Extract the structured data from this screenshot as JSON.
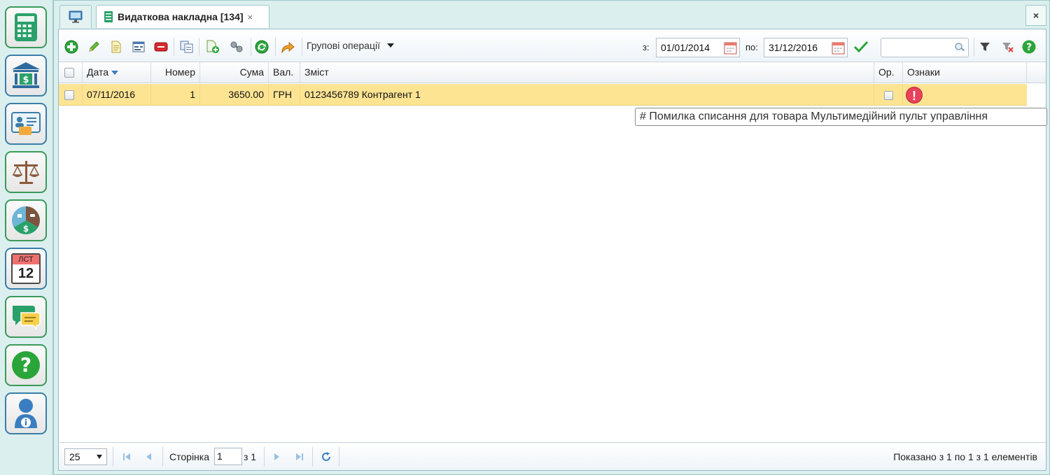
{
  "colors": {
    "sidebar_border_green": "#3a9a5a",
    "sidebar_border_blue": "#3a7ea8",
    "selected_row": "#fde493",
    "warning": "#e8435a",
    "accent_green": "#2aa53a"
  },
  "sidebar": {
    "items": [
      {
        "icon": "calculator-icon"
      },
      {
        "icon": "bank-icon"
      },
      {
        "icon": "contact-card-icon"
      },
      {
        "icon": "scales-icon"
      },
      {
        "icon": "property-chart-icon"
      },
      {
        "icon": "calendar-icon",
        "month": "ЛСТ",
        "day": "12"
      },
      {
        "icon": "chat-icon"
      },
      {
        "icon": "help-icon"
      },
      {
        "icon": "user-info-icon"
      }
    ]
  },
  "tabs": {
    "active_title": "Видаткова накладна [134]",
    "close_glyph": "×",
    "window_close_glyph": "×"
  },
  "toolbar": {
    "group_ops_label": "Групові операції",
    "from_label": "з:",
    "from_date": "01/01/2014",
    "to_label": "по:",
    "to_date": "31/12/2016",
    "search_value": ""
  },
  "grid": {
    "columns": {
      "date": "Дата",
      "number": "Номер",
      "amount": "Сума",
      "currency": "Вал.",
      "content": "Зміст",
      "posted": "Ор.",
      "flags": "Ознаки"
    },
    "rows": [
      {
        "date": "07/11/2016",
        "number": "1",
        "amount": "3650.00",
        "currency": "ГРН",
        "content": "0123456789 Контрагент 1",
        "flag_glyph": "!"
      }
    ],
    "tooltip": "# Помилка списання для товара Мультимедійний пульт управління"
  },
  "pager": {
    "page_size": "25",
    "page_label": "Сторінка",
    "page_value": "1",
    "of_label": "з 1",
    "summary": "Показано з 1 по 1 з 1 елементів"
  }
}
